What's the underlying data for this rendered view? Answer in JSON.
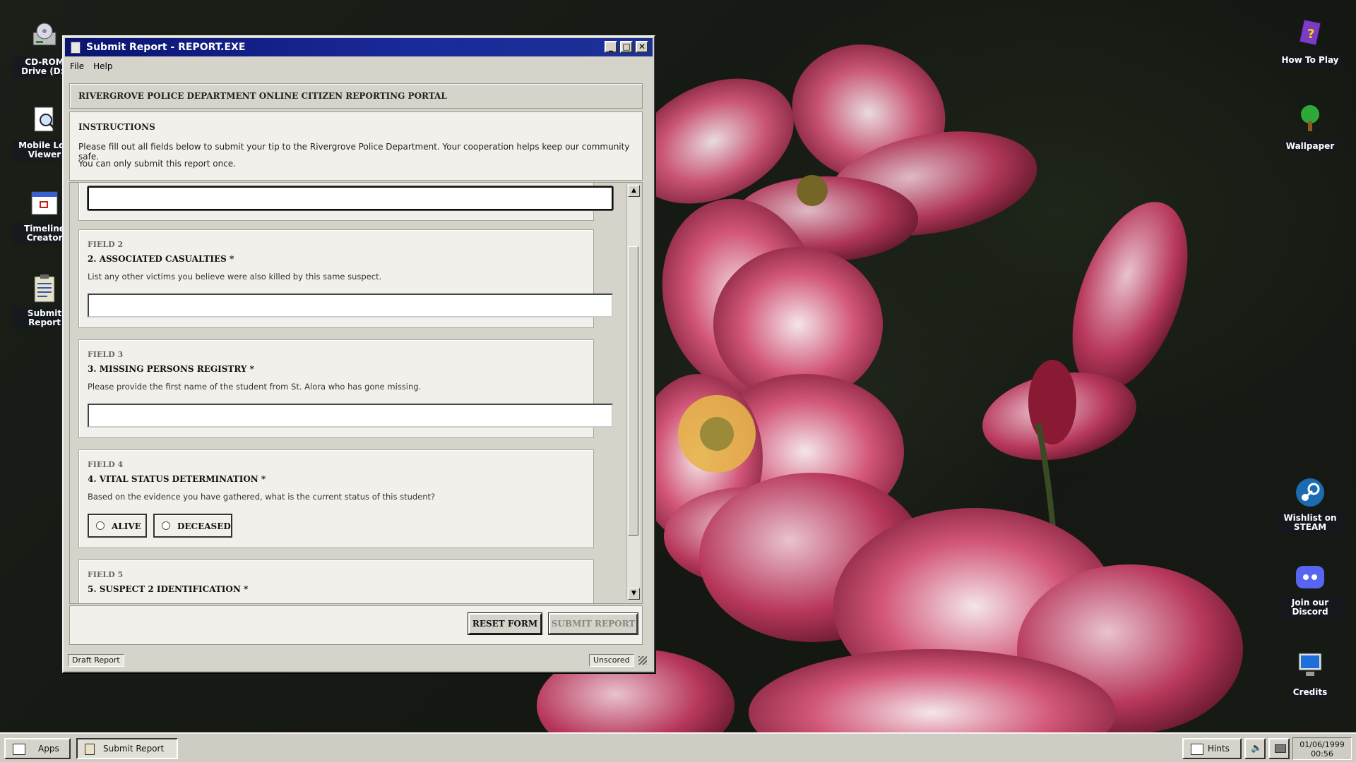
{
  "desktop": {
    "left_icons": [
      {
        "name": "cdrom",
        "label": "CD-ROM Drive (D:)"
      },
      {
        "name": "mobile",
        "label": "Mobile Log Viewer"
      },
      {
        "name": "timeline",
        "label": "Timeline Creator"
      },
      {
        "name": "submit",
        "label": "Submit Report"
      }
    ],
    "right_icons": [
      {
        "name": "howto",
        "label": "How To Play"
      },
      {
        "name": "wallpaper",
        "label": "Wallpaper"
      },
      {
        "name": "steam",
        "label": "Wishlist on STEAM"
      },
      {
        "name": "discord",
        "label": "Join our Discord"
      },
      {
        "name": "credits",
        "label": "Credits"
      }
    ]
  },
  "window": {
    "title": "Submit Report - REPORT.EXE",
    "menu": [
      "File",
      "Help"
    ],
    "header": "RIVERGROVE POLICE DEPARTMENT ONLINE CITIZEN REPORTING PORTAL",
    "instructions": {
      "heading": "INSTRUCTIONS",
      "line1": "Please fill out all fields below to submit your tip to the Rivergrove Police Department. Your cooperation helps keep our community safe.",
      "line2": "You can only submit this report once."
    },
    "fields": [
      {
        "num": "FIELD 2",
        "title": "2. ASSOCIATED CASUALTIES *",
        "desc": "List any other victims you believe were also killed by this same suspect.",
        "value": ""
      },
      {
        "num": "FIELD 3",
        "title": "3. MISSING PERSONS REGISTRY *",
        "desc": "Please provide the first name of the student from St. Alora who has gone missing.",
        "value": ""
      },
      {
        "num": "FIELD 4",
        "title": "4. VITAL STATUS DETERMINATION *",
        "desc": "Based on the evidence you have gathered, what is the current status of this student?",
        "options": [
          "ALIVE",
          "DECEASED"
        ]
      },
      {
        "num": "FIELD 5",
        "title": "5. SUSPECT 2 IDENTIFICATION *"
      }
    ],
    "buttons": {
      "reset": "RESET FORM",
      "submit": "SUBMIT REPORT"
    },
    "status": {
      "left": "Draft Report",
      "right": "Unscored"
    }
  },
  "taskbar": {
    "start": "Apps",
    "task": "Submit Report",
    "hints": "Hints",
    "date": "01/06/1999",
    "time": "00:56"
  }
}
